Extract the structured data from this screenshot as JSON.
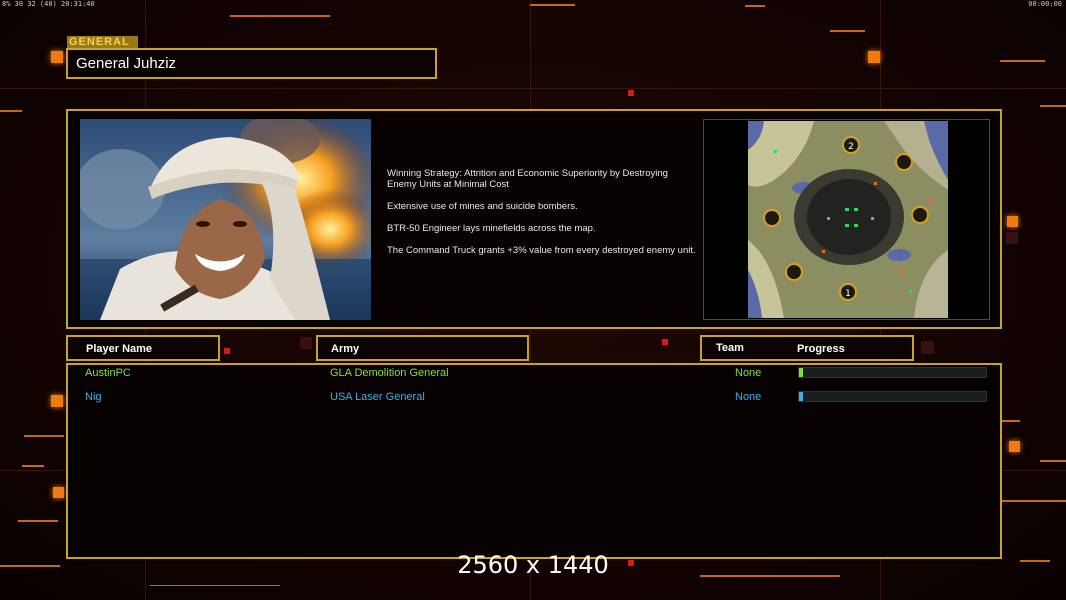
{
  "hud": {
    "top_left": "8% 30 32 (40) 20:31:40",
    "top_right": "00:00:00"
  },
  "general": {
    "tag": "GENERAL",
    "name": "General Juhziz",
    "description": [
      "Winning Strategy: Attrition and Economic Superiority by Destroying Enemy Units at Minimal Cost",
      "Extensive use of mines and suicide bombers.",
      "BTR-50 Engineer lays minefields across the map.",
      "The Command Truck grants +3% value from every destroyed enemy unit."
    ]
  },
  "minimap": {
    "start_labels": [
      "2",
      "1"
    ]
  },
  "table": {
    "headers": {
      "player_name": "Player Name",
      "army": "Army",
      "team": "Team",
      "progress": "Progress"
    },
    "rows": [
      {
        "name": "AustinPC",
        "army": "GLA Demolition General",
        "team": "None",
        "color": "#7ee040",
        "progress": 0.02
      },
      {
        "name": "Nig",
        "army": "USA Laser General",
        "team": "None",
        "color": "#3ab0e6",
        "progress": 0.01
      }
    ]
  },
  "resolution_label": "2560 x 1440",
  "colors": {
    "frame": "#c8a424",
    "accent": "#f07a10"
  }
}
